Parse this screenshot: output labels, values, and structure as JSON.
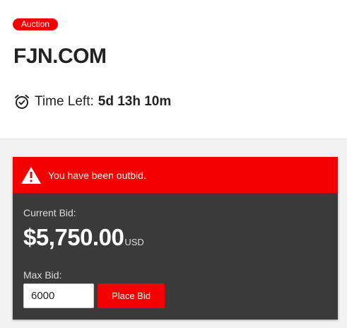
{
  "listing": {
    "badge": "Auction",
    "domain": "FJN.COM",
    "time_left_label": "Time Left:",
    "time_left_value": "5d 13h 10m",
    "time_icon": "alarm-clock-icon"
  },
  "bid_panel": {
    "alert_icon": "warning-triangle-icon",
    "alert_message": "You have been outbid.",
    "current_bid_label": "Current Bid:",
    "current_bid_amount": "$5,750.00",
    "current_bid_currency": "USD",
    "max_bid_label": "Max Bid:",
    "max_bid_value": "6000",
    "place_bid_label": "Place Bid"
  },
  "colors": {
    "accent_red": "#f40000",
    "panel_dark": "#3a3a3a",
    "page_background": "#f2f2f2"
  }
}
